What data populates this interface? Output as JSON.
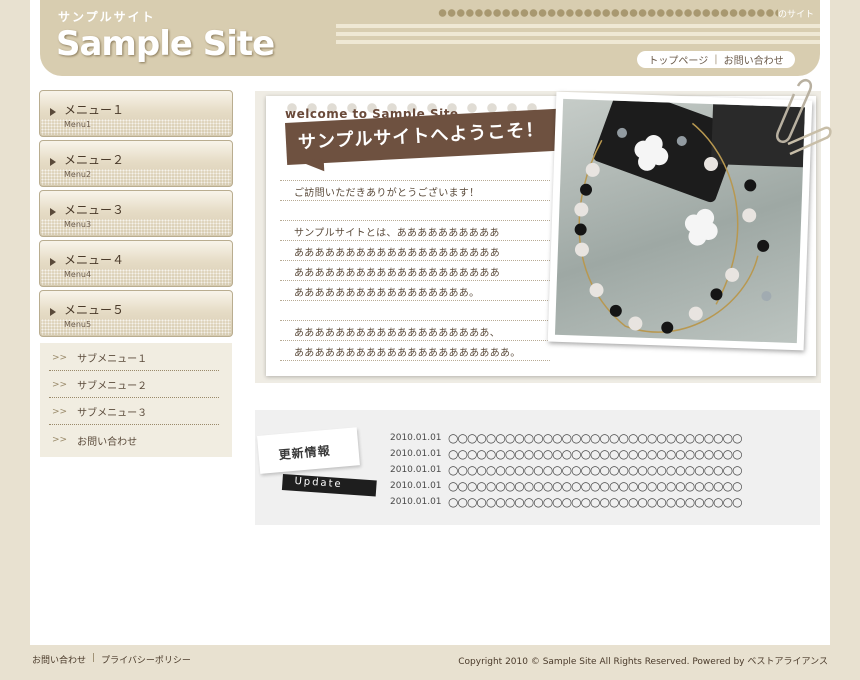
{
  "header": {
    "site_subtitle": "サンプルサイト",
    "site_title": "Sample Site",
    "tagline": "のサイト",
    "nav": [
      {
        "label": "トップページ"
      },
      {
        "label": "お問い合わせ"
      }
    ]
  },
  "sidebar": {
    "menus": [
      {
        "label": "メニュー１",
        "sub": "Menu1"
      },
      {
        "label": "メニュー２",
        "sub": "Menu2"
      },
      {
        "label": "メニュー３",
        "sub": "Menu3"
      },
      {
        "label": "メニュー４",
        "sub": "Menu4"
      },
      {
        "label": "メニュー５",
        "sub": "Menu5"
      }
    ],
    "submenu_marker": ">>",
    "submenus": [
      {
        "label": "サブメニュー１"
      },
      {
        "label": "サブメニュー２"
      },
      {
        "label": "サブメニュー３"
      },
      {
        "label": "お問い合わせ"
      }
    ]
  },
  "welcome": {
    "heading_en": "welcome to Sample Site",
    "heading_jp": "サンプルサイトへようこそ！",
    "lines": [
      "ご訪問いただきありがとうございます！",
      "サンプルサイトとは、ああああああああああ",
      "ああああああああああああああああああああ",
      "ああああああああああああああああああああ",
      "あああああああああああああああああ。",
      "あああああああああああああああああああ、",
      "あああああああああああああああああああああ。"
    ]
  },
  "updates": {
    "title_jp": "更新情報",
    "title_en": "Update",
    "items": [
      {
        "date": "2010.01.01",
        "text": "○○○○○○○○○○○○○○○○○○○○○○○○○○○○○○○"
      },
      {
        "date": "2010.01.01",
        "text": "○○○○○○○○○○○○○○○○○○○○○○○○○○○○○○○"
      },
      {
        "date": "2010.01.01",
        "text": "○○○○○○○○○○○○○○○○○○○○○○○○○○○○○○○"
      },
      {
        "date": "2010.01.01",
        "text": "○○○○○○○○○○○○○○○○○○○○○○○○○○○○○○○"
      },
      {
        "date": "2010.01.01",
        "text": "○○○○○○○○○○○○○○○○○○○○○○○○○○○○○○○"
      }
    ]
  },
  "footer": {
    "links": [
      {
        "label": "お問い合わせ"
      },
      {
        "label": "プライバシーポリシー"
      }
    ],
    "link_separator": "|",
    "copyright": "Copyright 2010 © Sample Site All Rights Reserved.  Powered by ベストアライアンス"
  },
  "colors": {
    "background": "#e8e1d0",
    "header": "#d8cdb0",
    "banner": "#6e5140",
    "submenu_bg": "#f1ede1"
  }
}
